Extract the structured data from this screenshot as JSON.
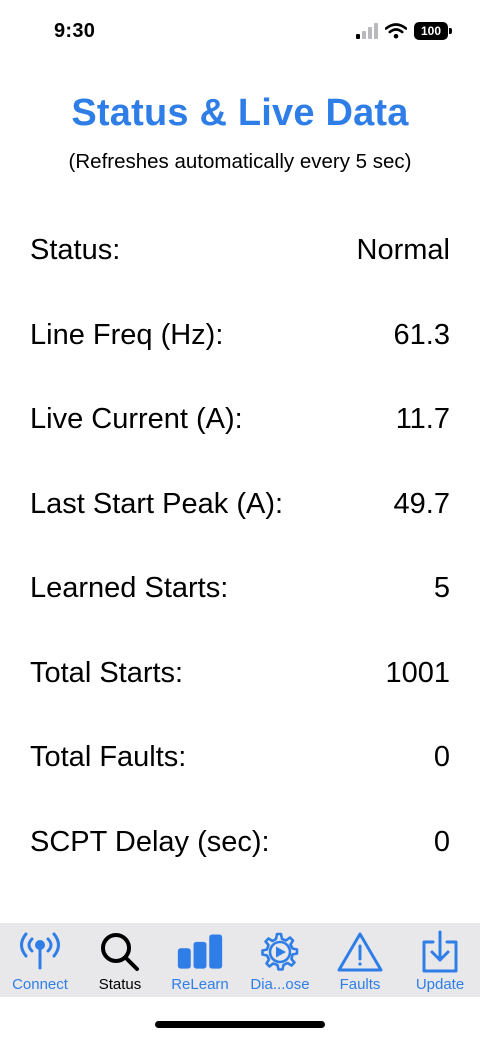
{
  "status_bar": {
    "time": "9:30",
    "battery": "100"
  },
  "header": {
    "title": "Status & Live Data",
    "subtitle": "(Refreshes automatically every 5 sec)"
  },
  "rows": [
    {
      "label": "Status:",
      "value": "Normal"
    },
    {
      "label": "Line Freq (Hz):",
      "value": "61.3"
    },
    {
      "label": "Live Current (A):",
      "value": "11.7"
    },
    {
      "label": "Last Start Peak (A):",
      "value": "49.7"
    },
    {
      "label": "Learned Starts:",
      "value": "5"
    },
    {
      "label": "Total Starts:",
      "value": "1001"
    },
    {
      "label": "Total Faults:",
      "value": "0"
    },
    {
      "label": "SCPT Delay (sec):",
      "value": "0"
    }
  ],
  "tabs": [
    {
      "label": "Connect",
      "icon": "antenna-icon"
    },
    {
      "label": "Status",
      "icon": "magnifier-icon",
      "active": true
    },
    {
      "label": "ReLearn",
      "icon": "bars-icon"
    },
    {
      "label": "Dia...ose",
      "icon": "gear-icon"
    },
    {
      "label": "Faults",
      "icon": "warning-icon"
    },
    {
      "label": "Update",
      "icon": "download-icon"
    }
  ],
  "colors": {
    "accent": "#2f7ee8",
    "tabbar_bg": "#e8e8ea",
    "text": "#000000"
  }
}
